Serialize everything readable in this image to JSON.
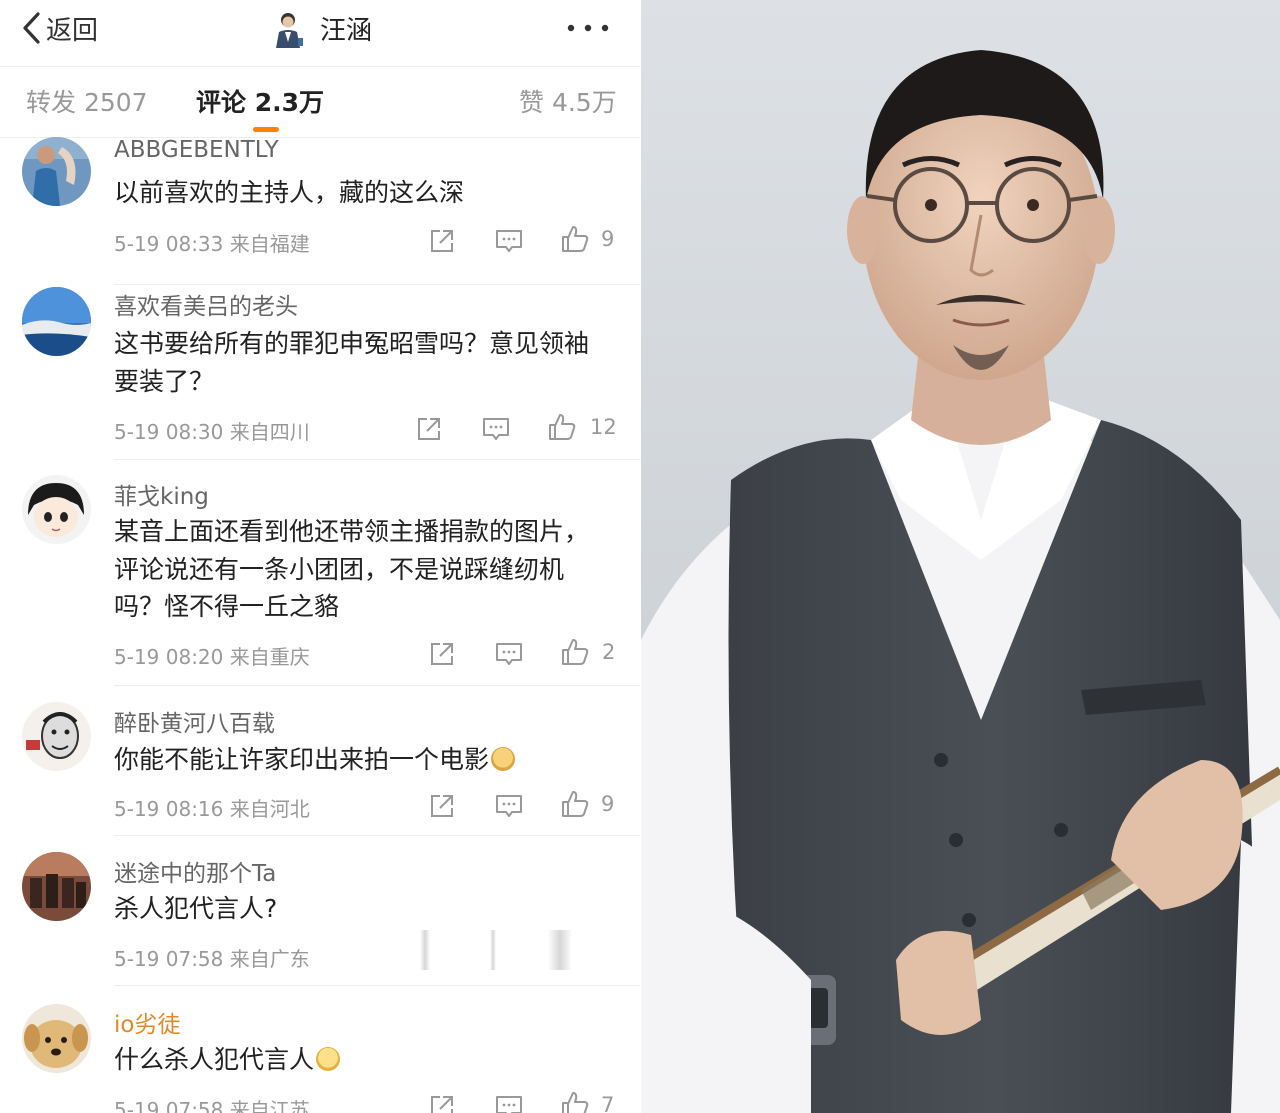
{
  "header": {
    "back_label": "返回",
    "title": "汪涵"
  },
  "tabs": [
    {
      "label": "转发 2507",
      "active": false
    },
    {
      "label": "评论 2.3万",
      "active": true
    },
    {
      "label": "赞 4.5万",
      "active": false
    }
  ],
  "comments": [
    {
      "user": "ABBGEBENTLY",
      "text": "以前喜欢的主持人，藏的这么深",
      "meta": "5-19 08:33 来自福建",
      "likes": "9"
    },
    {
      "user": "喜欢看美吕的老头",
      "text": "这书要给所有的罪犯申冤昭雪吗？意见领袖要装了？",
      "meta": "5-19 08:30 来自四川",
      "likes": "12"
    },
    {
      "user": "菲戈king",
      "text": "某音上面还看到他还带领主播捐款的图片，评论说还有一条小团团，不是说踩缝纫机吗？怪不得一丘之貉",
      "meta": "5-19 08:20 来自重庆",
      "likes": "2"
    },
    {
      "user": "醉卧黄河八百载",
      "text": "你能不能让许家印出来拍一个电影",
      "meta": "5-19 08:16 来自河北",
      "likes": "9"
    },
    {
      "user": "迷途中的那个Ta",
      "text": "杀人犯代言人?",
      "meta": "5-19 07:58 来自广东",
      "likes": ""
    },
    {
      "user": "io劣徒",
      "text": "什么杀人犯代言人",
      "meta": "5-19 07:58 来自江苏",
      "likes": "7"
    }
  ],
  "colors": {
    "accent": "#ff8200",
    "gold_username": "#e3882a"
  }
}
